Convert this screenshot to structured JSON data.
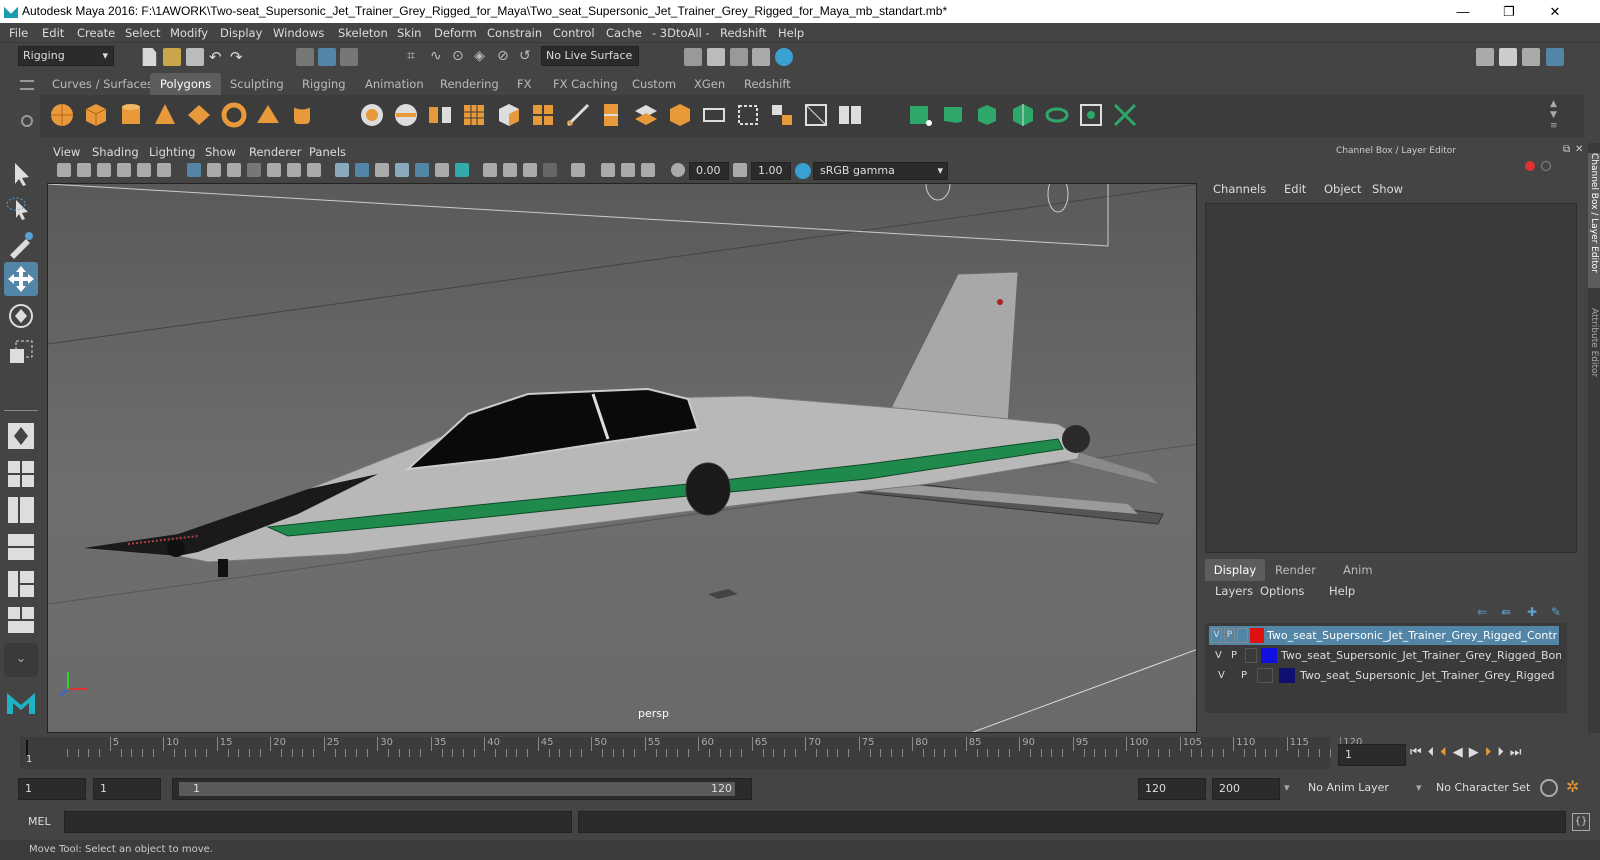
{
  "window": {
    "title": "Autodesk Maya 2016: F:\\1AWORK\\Two-seat_Supersonic_Jet_Trainer_Grey_Rigged_for_Maya\\Two_seat_Supersonic_Jet_Trainer_Grey_Rigged_for_Maya_mb_standart.mb*",
    "minimize": "—",
    "restore": "❐",
    "close": "✕"
  },
  "menubar": [
    "File",
    "Edit",
    "Create",
    "Select",
    "Modify",
    "Display",
    "Windows",
    "Skeleton",
    "Skin",
    "Deform",
    "Constrain",
    "Control",
    "Cache",
    "- 3DtoAll -",
    "Redshift",
    "Help"
  ],
  "status": {
    "menuset": "Rigging",
    "live_surface": "No Live Surface"
  },
  "shelf_tabs": [
    {
      "label": "Curves / Surfaces",
      "active": false
    },
    {
      "label": "Polygons",
      "active": true
    },
    {
      "label": "Sculpting",
      "active": false
    },
    {
      "label": "Rigging",
      "active": false
    },
    {
      "label": "Animation",
      "active": false
    },
    {
      "label": "Rendering",
      "active": false
    },
    {
      "label": "FX",
      "active": false
    },
    {
      "label": "FX Caching",
      "active": false
    },
    {
      "label": "Custom",
      "active": false
    },
    {
      "label": "XGen",
      "active": false
    },
    {
      "label": "Redshift",
      "active": false
    }
  ],
  "viewport": {
    "menu": [
      "View",
      "Shading",
      "Lighting",
      "Show",
      "Renderer",
      "Panels"
    ],
    "exposure": "0.00",
    "gamma": "1.00",
    "color_space": "sRGB gamma",
    "camera_label": "persp"
  },
  "channel_box": {
    "title": "Channel Box / Layer Editor",
    "menu": [
      "Channels",
      "Edit",
      "Object",
      "Show"
    ],
    "layer_tabs": [
      "Display",
      "Render",
      "Anim"
    ],
    "layer_menu": [
      "Layers",
      "Options",
      "Help"
    ],
    "layers": [
      {
        "v": "V",
        "p": "P",
        "name": "Two_seat_Supersonic_Jet_Trainer_Grey_Rigged_Controllers",
        "color": "#e01010",
        "selected": true
      },
      {
        "v": "V",
        "p": "P",
        "name": "Two_seat_Supersonic_Jet_Trainer_Grey_Rigged_Bones",
        "color": "#1010e0",
        "selected": false
      },
      {
        "v": "V",
        "p": "P",
        "name": "Two_seat_Supersonic_Jet_Trainer_Grey_Rigged",
        "color": "#101070",
        "selected": false
      }
    ],
    "side_tabs": [
      "Channel Box / Layer Editor",
      "Attribute Editor"
    ]
  },
  "timeline": {
    "ticks": [
      "5",
      "10",
      "15",
      "20",
      "25",
      "30",
      "35",
      "40",
      "45",
      "50",
      "55",
      "60",
      "65",
      "70",
      "75",
      "80",
      "85",
      "90",
      "95",
      "100",
      "105",
      "110",
      "115",
      "120"
    ],
    "start_label": "1",
    "current_frame": "1"
  },
  "range": {
    "start": "1",
    "playback_start": "1",
    "slider_start": "1",
    "slider_end": "120",
    "playback_end": "120",
    "end": "200",
    "anim_layer": "No Anim Layer",
    "character_set": "No Character Set"
  },
  "command_line": {
    "label": "MEL"
  },
  "help_line": "Move Tool: Select an object to move.",
  "colors": {
    "accent": "#5285a6",
    "ui_bg": "#444444",
    "field_bg": "#2b2b2b",
    "stripe": "#1f8a4c"
  }
}
